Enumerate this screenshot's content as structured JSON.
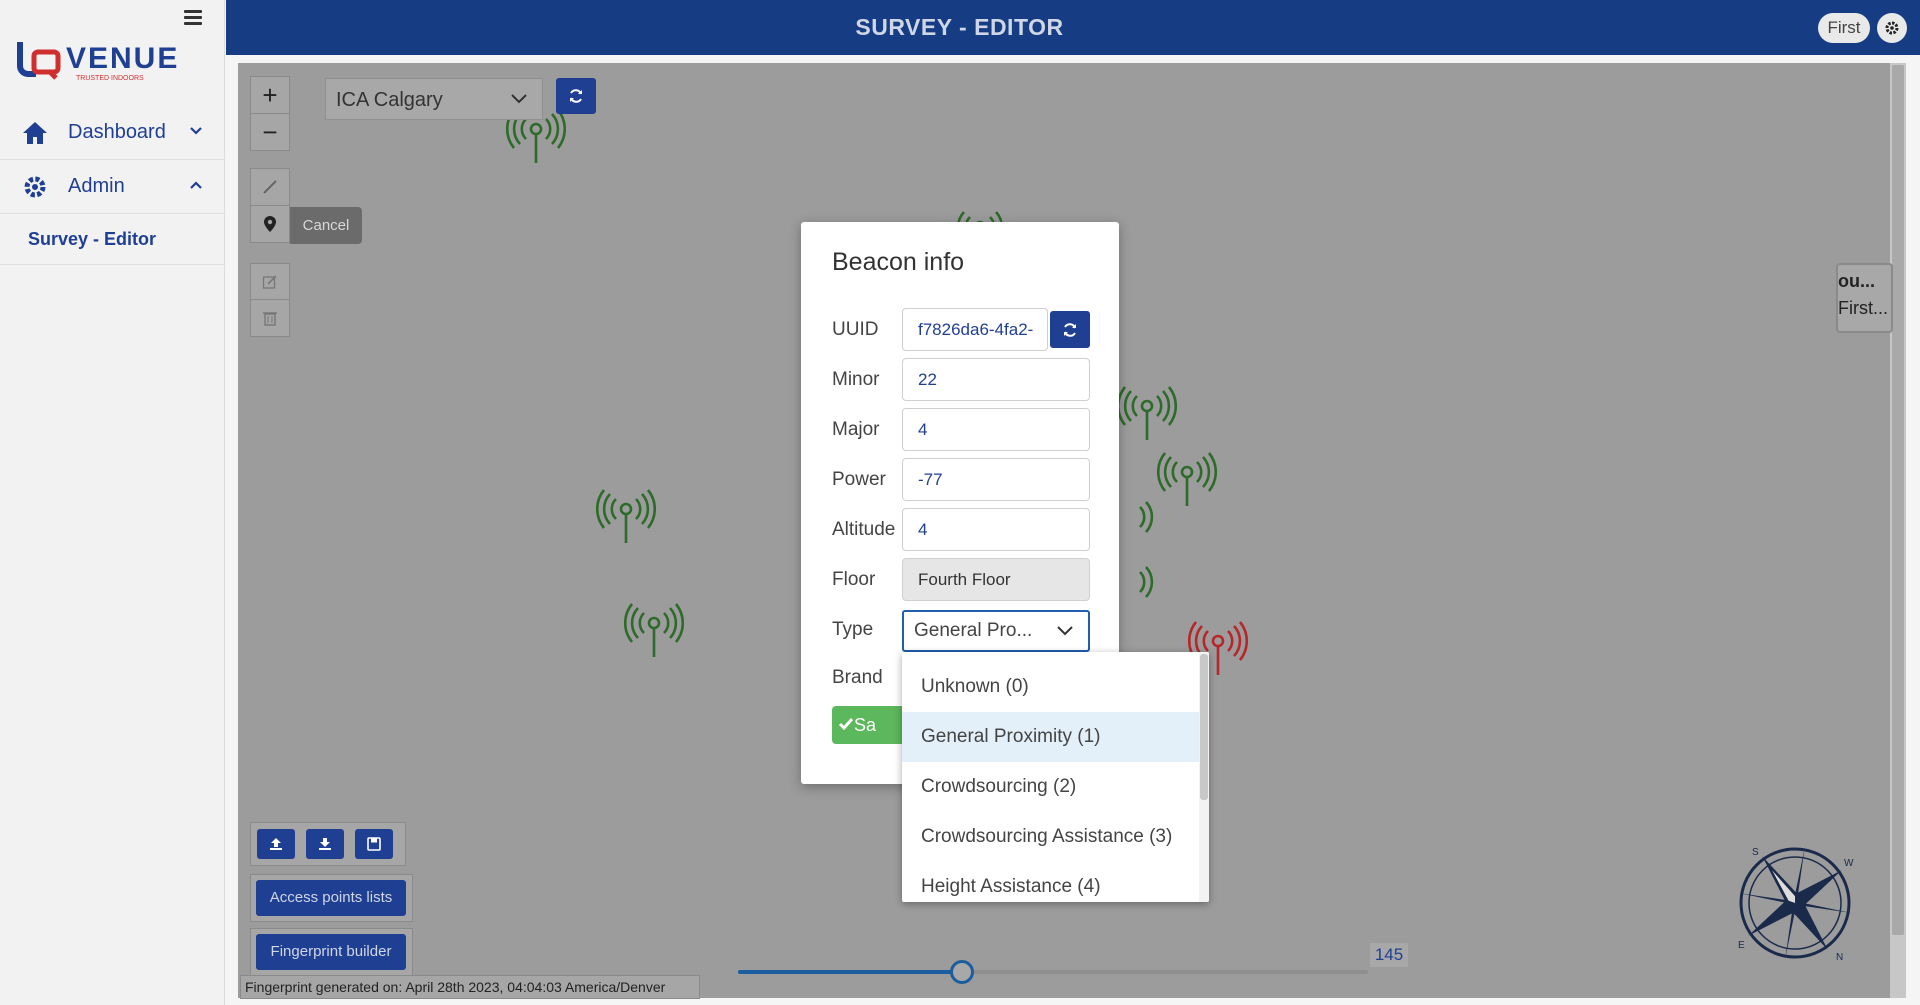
{
  "sidebar": {
    "logo_text": "VENUE",
    "logo_tagline": "TRUSTED INDOORS",
    "items": [
      {
        "label": "Dashboard"
      },
      {
        "label": "Admin"
      }
    ],
    "sub_item": "Survey - Editor"
  },
  "header": {
    "title": "SURVEY - EDITOR",
    "user": "First"
  },
  "map": {
    "venue": "ICA Calgary",
    "zoom_in": "+",
    "zoom_out": "−",
    "cancel_tooltip": "Cancel",
    "floor_panel": [
      "ou...",
      "First..."
    ],
    "buttons": {
      "access_points": "Access points lists",
      "fingerprint_builder": "Fingerprint builder"
    },
    "fingerprint_info": "Fingerprint generated on: April 28th 2023, 04:04:03 America/Denver",
    "slider_value": "145",
    "slider_fraction": 0.355,
    "compass_letters": [
      "S",
      "W",
      "N",
      "E"
    ]
  },
  "modal": {
    "title": "Beacon info",
    "fields": {
      "uuid": {
        "label": "UUID",
        "value": "f7826da6-4fa2-"
      },
      "minor": {
        "label": "Minor",
        "value": "22"
      },
      "major": {
        "label": "Major",
        "value": "4"
      },
      "power": {
        "label": "Power",
        "value": "-77"
      },
      "altitude": {
        "label": "Altitude",
        "value": "4"
      },
      "floor": {
        "label": "Floor",
        "value": "Fourth Floor"
      },
      "type": {
        "label": "Type",
        "value": "General Pro..."
      },
      "brand": {
        "label": "Brand"
      }
    },
    "save_label": "Sa"
  },
  "type_dropdown": {
    "options": [
      "Unknown (0)",
      "General Proximity (1)",
      "Crowdsourcing (2)",
      "Crowdsourcing Assistance (3)",
      "Height Assistance (4)"
    ],
    "selected_index": 1
  },
  "colors": {
    "brand_blue": "#163c84",
    "beacon_ok": "#2e6b2a",
    "beacon_alert": "#b8262a",
    "save_green": "#5cb85c"
  }
}
